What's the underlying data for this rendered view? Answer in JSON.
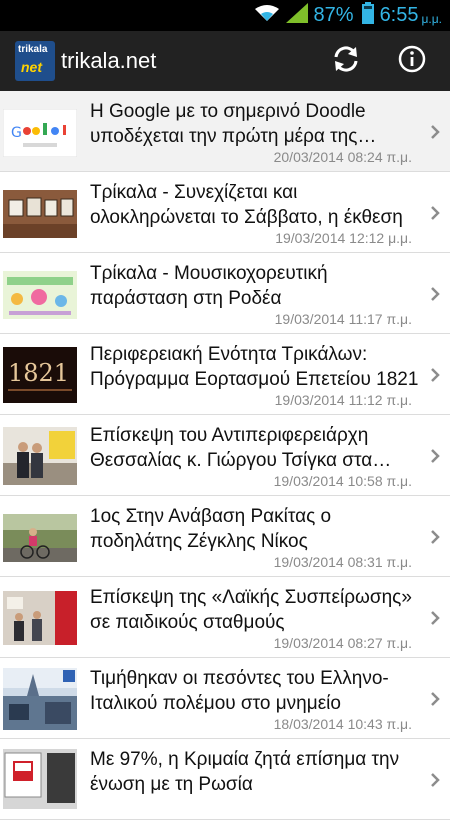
{
  "status_bar": {
    "battery_percent": "87%",
    "time": "6:55",
    "ampm": "μ.μ."
  },
  "action_bar": {
    "logo_text_top": "trikala",
    "logo_text_bottom": "net",
    "title": "trikala.net",
    "icons": [
      "refresh-icon",
      "info-icon"
    ]
  },
  "articles": [
    {
      "title": "Η Google με το σημερινό Doodle υποδέχεται την πρώτη μέρα της άνοιξης",
      "date": "20/03/2014 08:24 π.μ.",
      "thumb": "doodle"
    },
    {
      "title": "Τρίκαλα - Συνεχίζεται και ολοκληρώνεται το Σάββατο, η έκθεση",
      "date": "19/03/2014 12:12 μ.μ.",
      "thumb": "gallery"
    },
    {
      "title": "Τρίκαλα - Μουσικοχορευτική παράσταση στη Ροδέα",
      "date": "19/03/2014 11:17 π.μ.",
      "thumb": "poster"
    },
    {
      "title": "Περιφερειακή Ενότητα Τρικάλων: Πρόγραμμα Εορτασμού Επετείου 1821",
      "date": "19/03/2014 11:12 π.μ.",
      "thumb": "1821"
    },
    {
      "title": "Επίσκεψη του Αντιπεριφερειάρχη Θεσσαλίας κ. Γιώργου Τσίγκα στα σχολεία",
      "date": "19/03/2014 10:58 π.μ.",
      "thumb": "office"
    },
    {
      "title": "1ος Στην Ανάβαση Ρακίτας ο ποδηλάτης Ζέγκλης Νίκος",
      "date": "19/03/2014 08:31 π.μ.",
      "thumb": "cyclist"
    },
    {
      "title": "Επίσκεψη της «Λαϊκής Συσπείρωσης» σε παιδικούς σταθμούς",
      "date": "19/03/2014 08:27 π.μ.",
      "thumb": "visit"
    },
    {
      "title": "Τιμήθηκαν οι πεσόντες του Ελληνο-Ιταλικού πολέμου στο μνημείο",
      "date": "18/03/2014 10:43 π.μ.",
      "thumb": "ceremony"
    },
    {
      "title": "Με  97%, η Κριμαία ζητά επίσημα την ένωση με τη Ρωσία",
      "date": "",
      "thumb": "crimea"
    }
  ]
}
